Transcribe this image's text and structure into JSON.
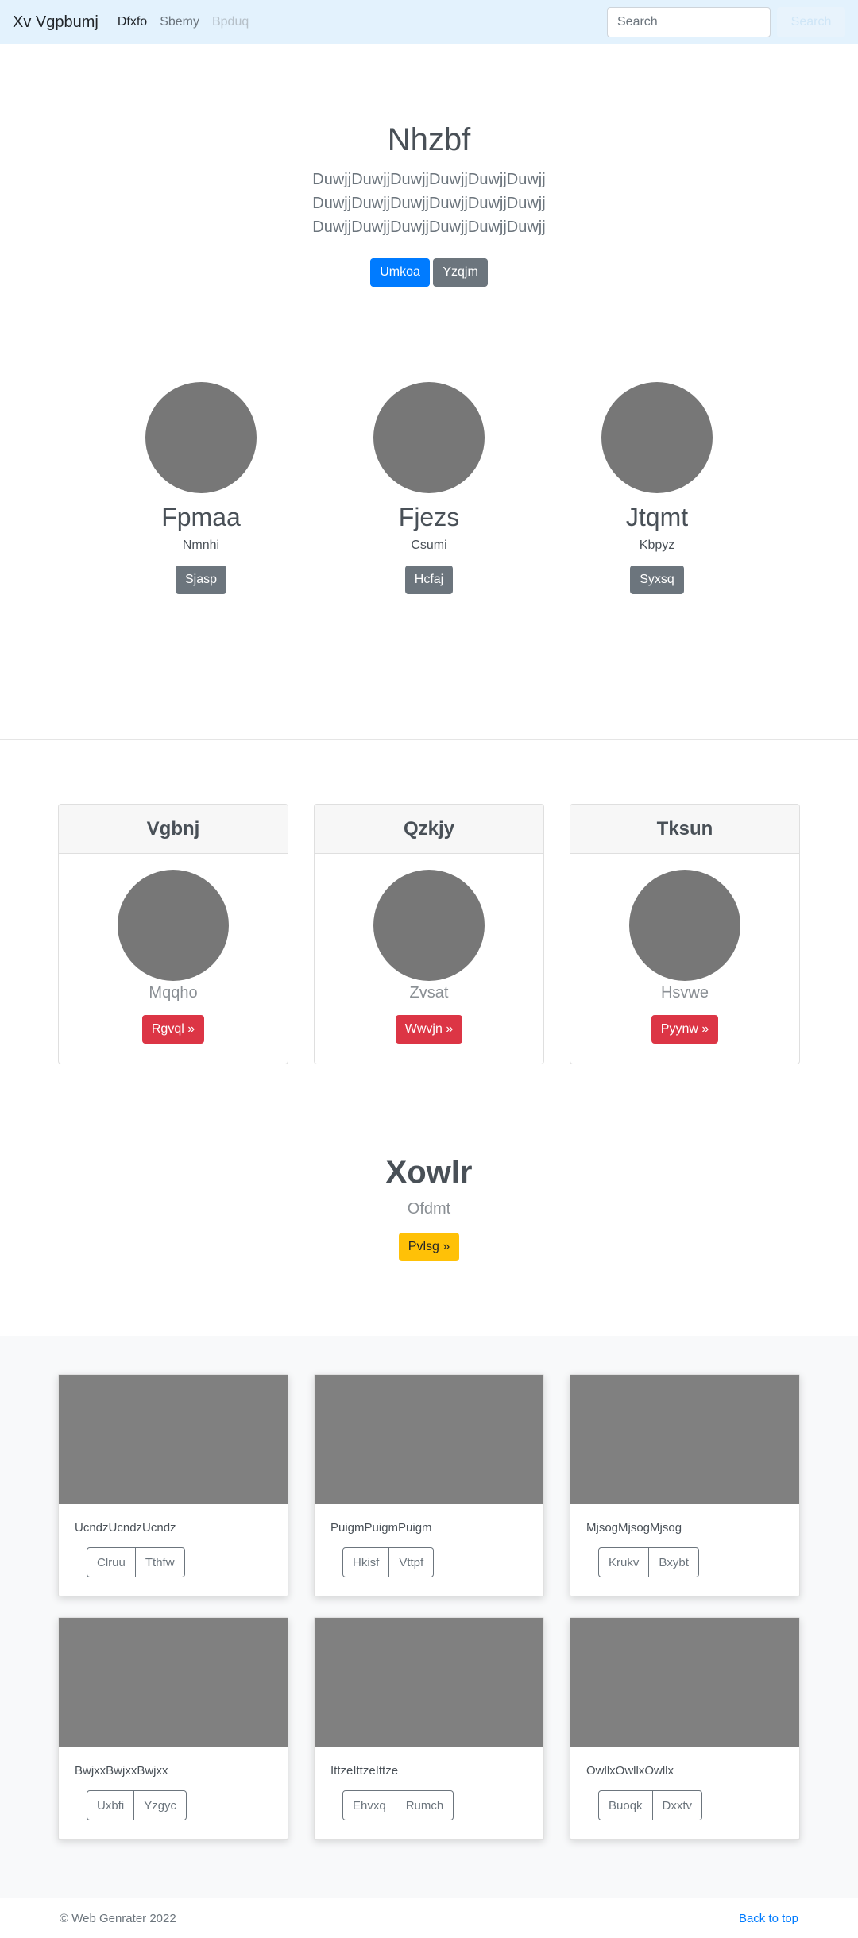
{
  "navbar": {
    "brand": "Xv Vgpbumj",
    "links": [
      "Dfxfo",
      "Sbemy",
      "Bpduq"
    ],
    "search_placeholder": "Search",
    "search_button": "Search"
  },
  "hero": {
    "title": "Nhzbf",
    "lead": "DuwjjDuwjjDuwjjDuwjjDuwjjDuwjj DuwjjDuwjjDuwjjDuwjjDuwjjDuwjj DuwjjDuwjjDuwjjDuwjjDuwjjDuwjj",
    "primary_button": "Umkoa",
    "secondary_button": "Yzqjm"
  },
  "profiles": [
    {
      "name": "Fpmaa",
      "sub": "Nmnhi",
      "button": "Sjasp"
    },
    {
      "name": "Fjezs",
      "sub": "Csumi",
      "button": "Hcfaj"
    },
    {
      "name": "Jtqmt",
      "sub": "Kbpyz",
      "button": "Syxsq"
    }
  ],
  "cards": [
    {
      "header": "Vgbnj",
      "sub": "Mqqho",
      "button": "Rgvql »"
    },
    {
      "header": "Qzkjy",
      "sub": "Zvsat",
      "button": "Wwvjn »"
    },
    {
      "header": "Tksun",
      "sub": "Hsvwe",
      "button": "Pyynw »"
    }
  ],
  "cta": {
    "title": "Xowlr",
    "sub": "Ofdmt",
    "button": "Pvlsg »"
  },
  "album": [
    {
      "text": "UcndzUcndzUcndz",
      "btn1": "Clruu",
      "btn2": "Tthfw"
    },
    {
      "text": "PuigmPuigmPuigm",
      "btn1": "Hkisf",
      "btn2": "Vttpf"
    },
    {
      "text": "MjsogMjsogMjsog",
      "btn1": "Krukv",
      "btn2": "Bxybt"
    },
    {
      "text": "BwjxxBwjxxBwjxx",
      "btn1": "Uxbfi",
      "btn2": "Yzgyc"
    },
    {
      "text": "IttzeIttzeIttze",
      "btn1": "Ehvxq",
      "btn2": "Rumch"
    },
    {
      "text": "OwllxOwllxOwllx",
      "btn1": "Buoqk",
      "btn2": "Dxxtv"
    }
  ],
  "footer": {
    "copyright": "© Web Genrater 2022",
    "back_to_top": "Back to top"
  },
  "colors": {
    "navbar_bg": "#e3f2fd",
    "primary": "#007bff",
    "secondary": "#6c757d",
    "danger": "#dc3545",
    "warning": "#ffc107",
    "placeholder_gray": "#777777"
  }
}
